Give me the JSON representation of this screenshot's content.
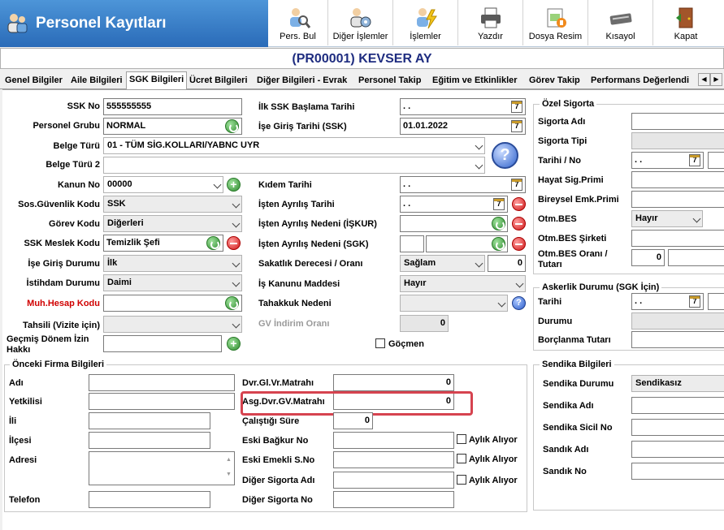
{
  "app": {
    "title": "Personel Kayıtları"
  },
  "toolbar": [
    {
      "label": "Pers. Bul",
      "icon": "person-search-icon"
    },
    {
      "label": "Diğer İşlemler",
      "icon": "people-settings-icon"
    },
    {
      "label": "İşlemler",
      "icon": "lightning-icon"
    },
    {
      "label": "Yazdır",
      "icon": "printer-icon"
    },
    {
      "label": "Dosya Resim",
      "icon": "file-image-icon"
    },
    {
      "label": "Kısayol",
      "icon": "keyboard-icon"
    },
    {
      "label": "Kapat",
      "icon": "exit-door-icon"
    }
  ],
  "record": {
    "title": "(PR00001) KEVSER AY"
  },
  "tabs": [
    "Genel Bilgiler",
    "Aile Bilgileri",
    "SGK Bilgileri",
    "Ücret Bilgileri",
    "Diğer Bilgileri - Evrak",
    "Personel Takip",
    "Eğitim ve Etkinlikler",
    "Görev Takip",
    "Performans Değerlendi"
  ],
  "left": {
    "ssk_no": {
      "label": "SSK No",
      "value": "555555555"
    },
    "personel_grubu": {
      "label": "Personel Grubu",
      "value": "NORMAL"
    },
    "belge_turu": {
      "label": "Belge Türü",
      "value": "01 - TÜM SİG.KOLLARI/YABNC UYR"
    },
    "belge_turu2": {
      "label": "Belge Türü 2",
      "value": ""
    },
    "kanun_no": {
      "label": "Kanun No",
      "value": "00000"
    },
    "sos_guvenlik": {
      "label": "Sos.Güvenlik Kodu",
      "value": "SSK"
    },
    "gorev_kodu": {
      "label": "Görev Kodu",
      "value": "Diğerleri"
    },
    "ssk_meslek": {
      "label": "SSK Meslek Kodu",
      "value": "Temizlik Şefi"
    },
    "ise_giris_durumu": {
      "label": "İşe Giriş Durumu",
      "value": "İlk"
    },
    "istihdam": {
      "label": "İstihdam Durumu",
      "value": "Daimi"
    },
    "muh_hesap": {
      "label": "Muh.Hesap Kodu",
      "value": ""
    },
    "tahsili": {
      "label": "Tahsili (Vizite için)",
      "value": ""
    },
    "gecmis_izin": {
      "label1": "Geçmiş Dönem İzin",
      "label2": "Hakkı",
      "value": ""
    }
  },
  "mid": {
    "ilk_ssk": {
      "label": "İlk SSK Başlama Tarihi",
      "value": ". ."
    },
    "ise_giris_tarihi": {
      "label": "İşe Giriş Tarihi (SSK)",
      "value": "01.01.2022"
    },
    "kidem": {
      "label": "Kıdem Tarihi",
      "value": ". ."
    },
    "isten_ayrilis": {
      "label": "İşten Ayrılış Tarihi",
      "value": ". ."
    },
    "ayrilis_iskur": {
      "label": "İşten Ayrılış Nedeni (İŞKUR)",
      "value": ""
    },
    "ayrilis_sgk": {
      "label": "İşten Ayrılış Nedeni (SGK)",
      "value1": "",
      "value2": ""
    },
    "saglik": {
      "label": "Sakatlık Derecesi / Oranı",
      "value": "Sağlam",
      "rate": "0"
    },
    "is_kanunu": {
      "label": "İş Kanunu Maddesi",
      "value": "Hayır"
    },
    "tahakkuk": {
      "label": "Tahakkuk Nedeni",
      "value": ""
    },
    "gv_indirim": {
      "label": "GV İndirim Oranı",
      "value": "0"
    },
    "gocmen": {
      "label": "Göçmen"
    }
  },
  "onceki": {
    "title": "Önceki Firma Bilgileri",
    "adi": {
      "label": "Adı",
      "value": ""
    },
    "yetkilisi": {
      "label": "Yetkilisi",
      "value": ""
    },
    "ili": {
      "label": "İli",
      "value": ""
    },
    "ilcesi": {
      "label": "İlçesi",
      "value": ""
    },
    "adresi": {
      "label": "Adresi",
      "value": ""
    },
    "telefon": {
      "label": "Telefon",
      "value": ""
    },
    "dvr_gl": {
      "label": "Dvr.Gl.Vr.Matrahı",
      "value": "0"
    },
    "asg_dvr": {
      "label": "Asg.Dvr.GV.Matrahı",
      "value": "0"
    },
    "calistigi": {
      "label": "Çalıştığı Süre",
      "value": "0"
    },
    "eski_bagkur": {
      "label": "Eski Bağkur No",
      "value": ""
    },
    "eski_emekli": {
      "label": "Eski Emekli S.No",
      "value": ""
    },
    "diger_sig_adi": {
      "label": "Diğer Sigorta Adı",
      "value": ""
    },
    "diger_sig_no": {
      "label": "Diğer Sigorta No",
      "value": ""
    },
    "aylik_aliyor": "Aylık Alıyor"
  },
  "ozel": {
    "title": "Özel Sigorta",
    "sigorta_adi": "Sigorta Adı",
    "sigorta_tipi": "Sigorta Tipi",
    "tarih_no": {
      "label": "Tarihi / No",
      "value": ". ."
    },
    "hayat": "Hayat Sig.Primi",
    "bireysel": "Bireysel Emk.Primi",
    "otm_bes": {
      "label": "Otm.BES",
      "value": "Hayır"
    },
    "otm_bes_sirket": "Otm.BES Şirketi",
    "otm_bes_oran": {
      "label1": "Otm.BES Oranı /",
      "label2": "Tutarı",
      "value": "0"
    }
  },
  "askerlik": {
    "title": "Askerlik Durumu (SGK İçin)",
    "tarihi": {
      "label": "Tarihi",
      "value": ". ."
    },
    "durumu": "Durumu",
    "borclanma": "Borçlanma Tutarı"
  },
  "sendika": {
    "title": "Sendika Bilgileri",
    "durumu": {
      "label": "Sendika Durumu",
      "value": "Sendikasız"
    },
    "adi": "Sendika Adı",
    "sicil": "Sendika Sicil No",
    "sandik_adi": "Sandık Adı",
    "sandik_no": "Sandık No"
  }
}
